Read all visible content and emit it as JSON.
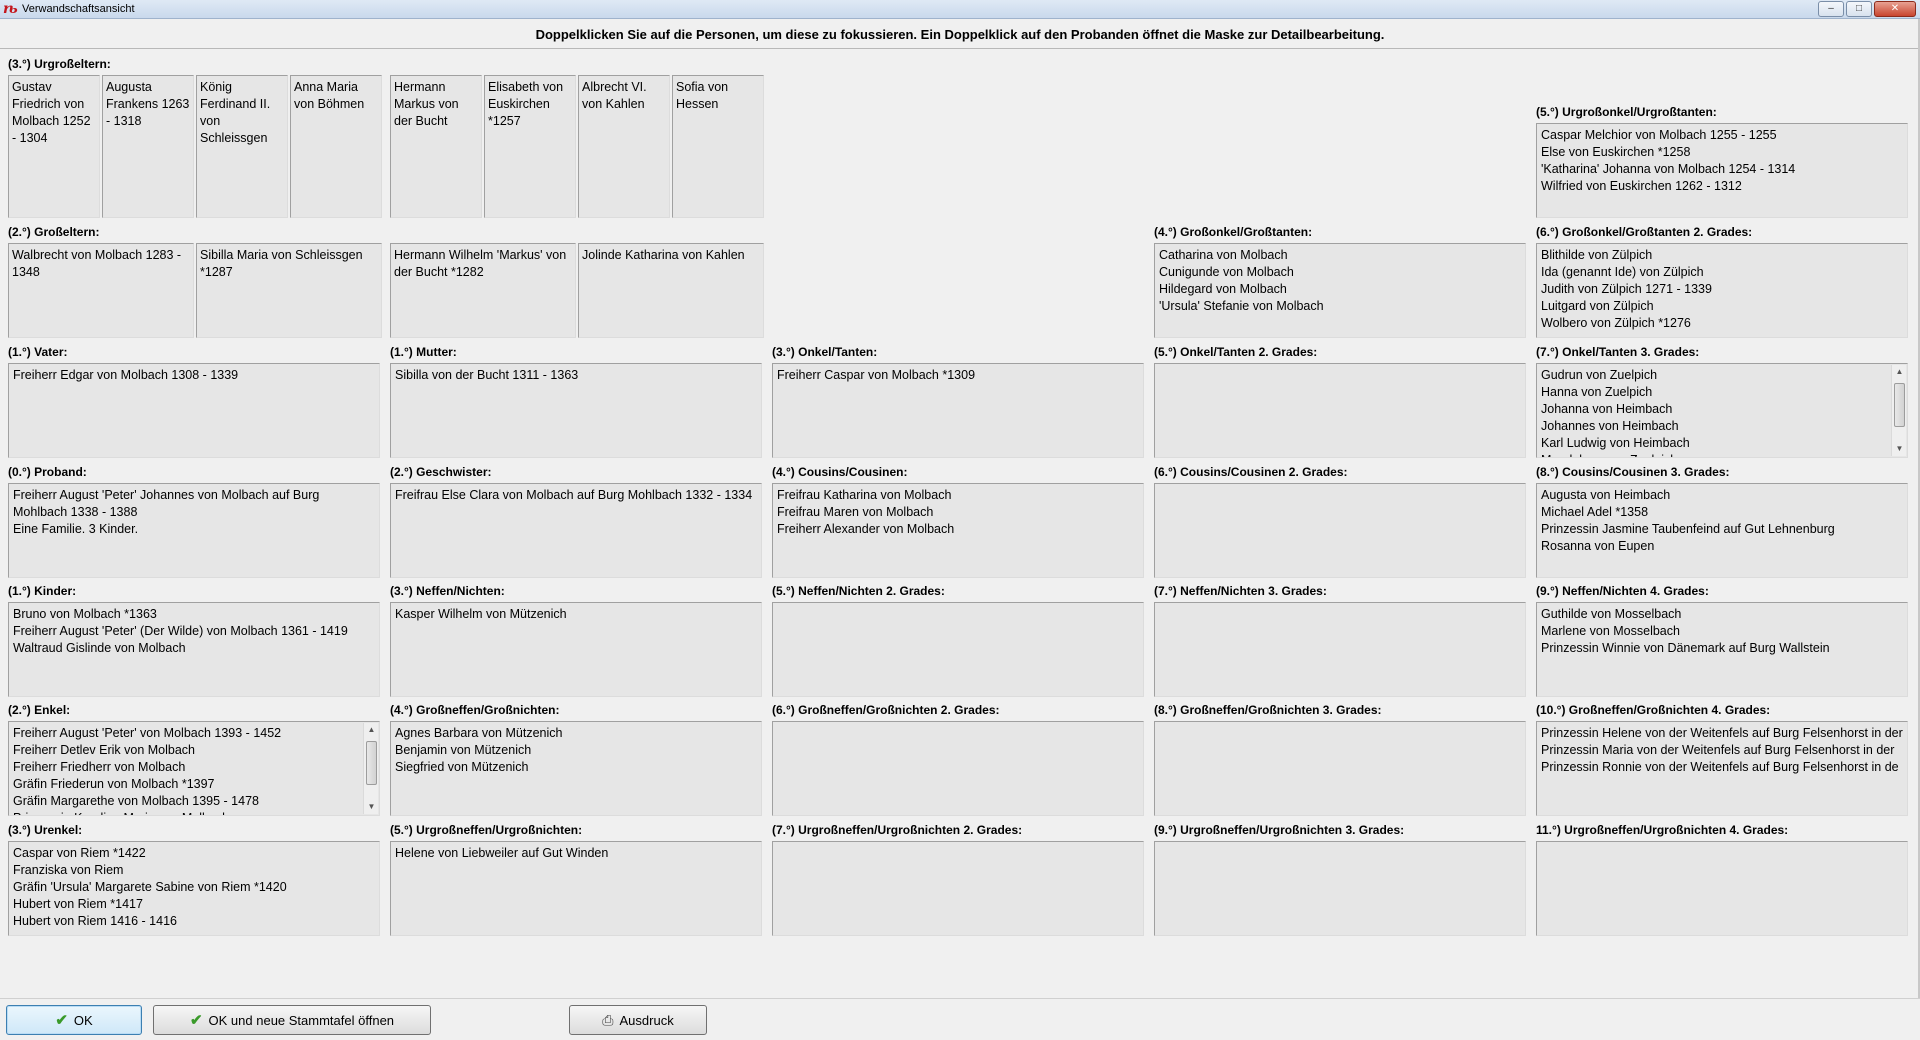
{
  "window": {
    "title": "Verwandschaftsansicht",
    "app_icon": "app-icon",
    "controls": [
      "minimize",
      "maximize",
      "close"
    ]
  },
  "instruction": "Doppelklicken Sie auf die Personen, um diese zu fokussieren. Ein Doppelklick auf den Probanden öffnet die Maske zur Detailbearbeitung.",
  "great_grandparents": {
    "label": "(3.°) Urgroßeltern:",
    "persons": [
      "Gustav Friedrich von Molbach 1252 - 1304",
      "Augusta Frankens 1263 - 1318",
      "König Ferdinand II. von Schleissgen",
      "Anna Maria von Böhmen",
      "Hermann Markus von der Bucht",
      "Elisabeth von Euskirchen *1257",
      "Albrecht VI. von Kahlen",
      "Sofia von Hessen"
    ]
  },
  "grandparents": {
    "label": "(2.°) Großeltern:",
    "persons": [
      "Walbrecht von Molbach 1283 - 1348",
      "Sibilla Maria von Schleissgen *1287",
      "Hermann Wilhelm 'Markus' von der Bucht *1282",
      "Jolinde Katharina von Kahlen"
    ]
  },
  "sections": [
    {
      "id": "urgrossonkel",
      "label": "(5.°) Urgroßonkel/Urgroßtanten:",
      "entries": [
        "Caspar Melchior von Molbach 1255 - 1255",
        "Else von Euskirchen *1258",
        "'Katharina' Johanna von Molbach 1254 - 1314",
        "Wilfried von Euskirchen 1262 - 1312"
      ]
    },
    {
      "id": "grossonkel",
      "label": "(4.°) Großonkel/Großtanten:",
      "entries": [
        "Catharina von Molbach",
        "Cunigunde von Molbach",
        "Hildegard von Molbach",
        "'Ursula' Stefanie von Molbach"
      ]
    },
    {
      "id": "grossonkel2",
      "label": "(6.°) Großonkel/Großtanten 2. Grades:",
      "entries": [
        "Blithilde von Zülpich",
        "Ida (genannt Ide) von Zülpich",
        "Judith von Zülpich 1271 - 1339",
        "Luitgard von Zülpich",
        "Wolbero von Zülpich *1276"
      ]
    },
    {
      "id": "vater",
      "label": "(1.°) Vater:",
      "entries": [
        "Freiherr Edgar von Molbach 1308 - 1339"
      ]
    },
    {
      "id": "mutter",
      "label": "(1.°) Mutter:",
      "entries": [
        "Sibilla von der Bucht 1311 - 1363"
      ]
    },
    {
      "id": "onkel",
      "label": "(3.°) Onkel/Tanten:",
      "entries": [
        "Freiherr Caspar von Molbach *1309"
      ]
    },
    {
      "id": "onkel2",
      "label": "(5.°) Onkel/Tanten 2. Grades:",
      "entries": []
    },
    {
      "id": "onkel3",
      "label": "(7.°) Onkel/Tanten 3. Grades:",
      "entries": [
        "Gudrun von Zuelpich",
        "Hanna von Zuelpich",
        "Johanna von Heimbach",
        "Johannes von Heimbach",
        "Karl Ludwig von Heimbach",
        "Magdalena von Zuelpich"
      ]
    },
    {
      "id": "proband",
      "label": "(0.°) Proband:",
      "entries": [
        "Freiherr August 'Peter' Johannes von Molbach auf Burg",
        "Mohlbach 1338 - 1388",
        "Eine Familie.  3 Kinder."
      ]
    },
    {
      "id": "geschwister",
      "label": "(2.°) Geschwister:",
      "entries": [
        "Freifrau Else Clara von Molbach auf Burg Mohlbach 1332 - 1334"
      ]
    },
    {
      "id": "cousins",
      "label": "(4.°) Cousins/Cousinen:",
      "entries": [
        "Freifrau Katharina von Molbach",
        "Freifrau Maren von Molbach",
        "Freiherr Alexander von Molbach"
      ]
    },
    {
      "id": "cousins2",
      "label": "(6.°) Cousins/Cousinen 2. Grades:",
      "entries": []
    },
    {
      "id": "cousins3",
      "label": "(8.°) Cousins/Cousinen 3. Grades:",
      "entries": [
        "Augusta von Heimbach",
        "Michael Adel *1358",
        "Prinzessin Jasmine Taubenfeind auf Gut Lehnenburg",
        "Rosanna von Eupen"
      ]
    },
    {
      "id": "kinder",
      "label": "(1.°) Kinder:",
      "entries": [
        "Bruno von Molbach *1363",
        "Freiherr August 'Peter' (Der Wilde) von Molbach 1361 - 1419",
        "Waltraud Gislinde von Molbach"
      ]
    },
    {
      "id": "neffen",
      "label": "(3.°) Neffen/Nichten:",
      "entries": [
        "Kasper Wilhelm von Mützenich"
      ]
    },
    {
      "id": "neffen2",
      "label": "(5.°) Neffen/Nichten 2. Grades:",
      "entries": []
    },
    {
      "id": "neffen3",
      "label": "(7.°) Neffen/Nichten 3. Grades:",
      "entries": []
    },
    {
      "id": "neffen4",
      "label": "(9.°) Neffen/Nichten 4. Grades:",
      "entries": [
        "Guthilde von Mosselbach",
        "Marlene von Mosselbach",
        "Prinzessin Winnie von Dänemark auf Burg Wallstein"
      ]
    },
    {
      "id": "enkel",
      "label": "(2.°) Enkel:",
      "entries": [
        "Freiherr August 'Peter' von Molbach 1393 - 1452",
        "Freiherr Detlev Erik von Molbach",
        "Freiherr Friedherr von Molbach",
        "Gräfin Friederun von Molbach *1397",
        "Gräfin Margarethe von Molbach 1395 - 1478",
        "Prinzessin Karoline Maria von Molbach"
      ]
    },
    {
      "id": "grossneffen",
      "label": "(4.°) Großneffen/Großnichten:",
      "entries": [
        "Agnes Barbara von Mützenich",
        "Benjamin von Mützenich",
        "Siegfried von Mützenich"
      ]
    },
    {
      "id": "grossneffen2",
      "label": "(6.°) Großneffen/Großnichten 2. Grades:",
      "entries": []
    },
    {
      "id": "grossneffen3",
      "label": "(8.°) Großneffen/Großnichten 3. Grades:",
      "entries": []
    },
    {
      "id": "grossneffen4",
      "label": "(10.°) Großneffen/Großnichten 4. Grades:",
      "entries": [
        "Prinzessin Helene von der Weitenfels auf Burg Felsenhorst in der",
        "Prinzessin Maria von der Weitenfels auf Burg Felsenhorst in der",
        "Prinzessin Ronnie von der Weitenfels auf Burg Felsenhorst in de"
      ]
    },
    {
      "id": "urenkel",
      "label": "(3.°) Urenkel:",
      "entries": [
        "Caspar von Riem *1422",
        "Franziska von Riem",
        "Gräfin 'Ursula' Margarete Sabine von Riem *1420",
        "Hubert von Riem *1417",
        "Hubert von Riem 1416 - 1416"
      ]
    },
    {
      "id": "urgrossneffen",
      "label": "(5.°) Urgroßneffen/Urgroßnichten:",
      "entries": [
        "Helene von Liebweiler auf Gut Winden"
      ]
    },
    {
      "id": "urgrossneffen2",
      "label": "(7.°) Urgroßneffen/Urgroßnichten 2. Grades:",
      "entries": []
    },
    {
      "id": "urgrossneffen3",
      "label": "(9.°) Urgroßneffen/Urgroßnichten 3. Grades:",
      "entries": []
    },
    {
      "id": "urgrossneffen4",
      "label": "11.°) Urgroßneffen/Urgroßnichten 4. Grades:",
      "entries": []
    }
  ],
  "buttons": {
    "ok": "OK",
    "ok_new": "OK und neue Stammtafel öffnen",
    "print": "Ausdruck"
  }
}
